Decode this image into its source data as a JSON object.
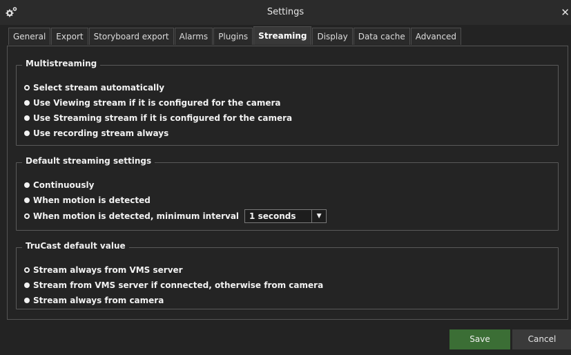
{
  "window": {
    "title": "Settings",
    "app_icon": "gears-icon",
    "close_label": "✕"
  },
  "tabs": [
    {
      "label": "General",
      "active": false
    },
    {
      "label": "Export",
      "active": false
    },
    {
      "label": "Storyboard export",
      "active": false
    },
    {
      "label": "Alarms",
      "active": false
    },
    {
      "label": "Plugins",
      "active": false
    },
    {
      "label": "Streaming",
      "active": true
    },
    {
      "label": "Display",
      "active": false
    },
    {
      "label": "Data cache",
      "active": false
    },
    {
      "label": "Advanced",
      "active": false
    }
  ],
  "multistreaming": {
    "title": "Multistreaming",
    "options": [
      {
        "label": "Select stream automatically",
        "selected": true
      },
      {
        "label": "Use Viewing stream if it is configured for the camera",
        "selected": false
      },
      {
        "label": "Use Streaming stream if it is configured for the camera",
        "selected": false
      },
      {
        "label": "Use recording stream always",
        "selected": false
      }
    ]
  },
  "default_streaming": {
    "title": "Default streaming settings",
    "options": [
      {
        "label": "Continuously",
        "selected": false
      },
      {
        "label": "When motion is detected",
        "selected": false
      },
      {
        "label": "When motion is detected, minimum interval",
        "selected": true
      }
    ],
    "interval_value": "1 seconds"
  },
  "trucast": {
    "title": "TruCast default value",
    "options": [
      {
        "label": "Stream always from VMS server",
        "selected": true
      },
      {
        "label": "Stream from VMS server if connected, otherwise from camera",
        "selected": false
      },
      {
        "label": "Stream always from camera",
        "selected": false
      }
    ]
  },
  "footer": {
    "save_label": "Save",
    "cancel_label": "Cancel"
  },
  "colors": {
    "background": "#232323",
    "save_button": "#3b6e35",
    "accent_text": "#f2f2f2"
  }
}
